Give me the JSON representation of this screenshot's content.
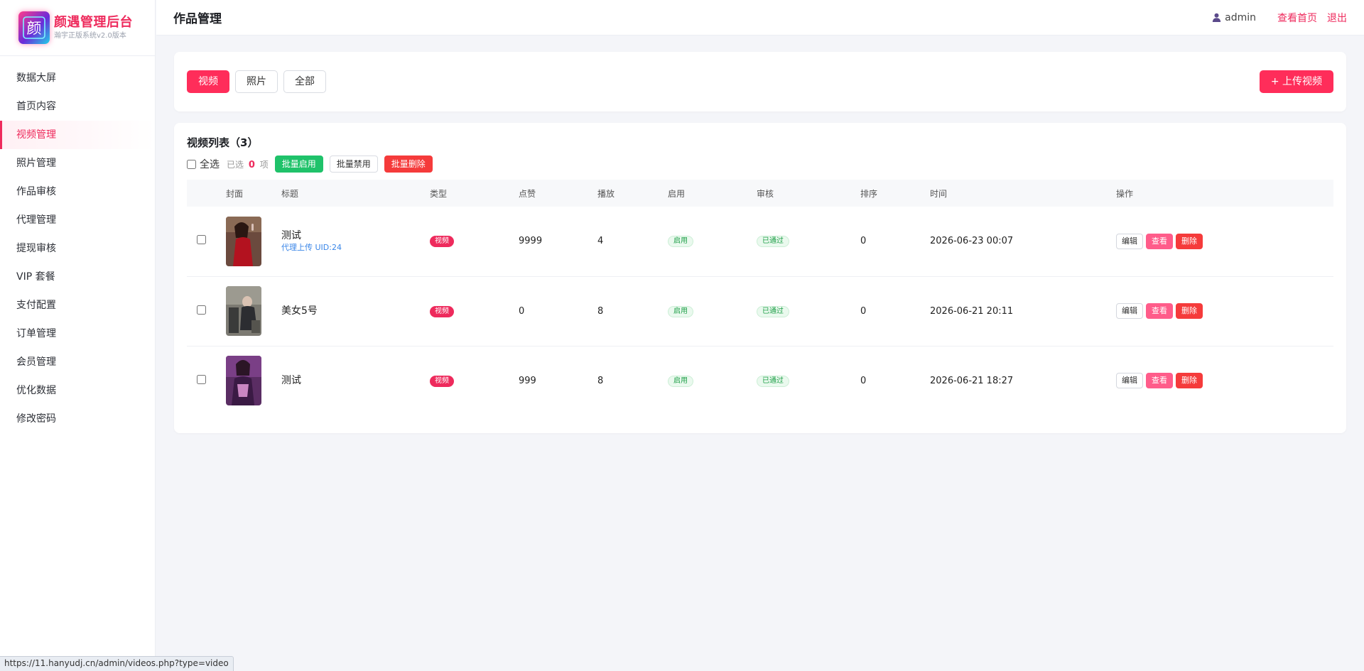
{
  "brand": {
    "title": "颜遇管理后台",
    "subtitle": "瀚宇正版系统v2.0版本",
    "logo_char": "颜"
  },
  "sidebar": {
    "items": [
      {
        "label": "数据大屏",
        "active": false
      },
      {
        "label": "首页内容",
        "active": false
      },
      {
        "label": "视频管理",
        "active": true
      },
      {
        "label": "照片管理",
        "active": false
      },
      {
        "label": "作品审核",
        "active": false
      },
      {
        "label": "代理管理",
        "active": false
      },
      {
        "label": "提现审核",
        "active": false
      },
      {
        "label": "VIP 套餐",
        "active": false
      },
      {
        "label": "支付配置",
        "active": false
      },
      {
        "label": "订单管理",
        "active": false
      },
      {
        "label": "会员管理",
        "active": false
      },
      {
        "label": "优化数据",
        "active": false
      },
      {
        "label": "修改密码",
        "active": false
      }
    ]
  },
  "header": {
    "title": "作品管理",
    "user": "admin",
    "home_link": "查看首页",
    "logout_link": "退出"
  },
  "filters": {
    "video": "视频",
    "photo": "照片",
    "all": "全部",
    "upload": "+ 上传视频"
  },
  "list": {
    "title": "视频列表（3）",
    "select_all": "全选",
    "selected_prefix": "已选",
    "selected_count": "0",
    "selected_suffix": "项",
    "batch_enable": "批量启用",
    "batch_disable": "批量禁用",
    "batch_delete": "批量删除",
    "columns": [
      "封面",
      "标题",
      "类型",
      "点赞",
      "播放",
      "启用",
      "审核",
      "排序",
      "时间",
      "操作"
    ],
    "ops": {
      "edit": "编辑",
      "view": "查看",
      "delete": "删除"
    },
    "rows": [
      {
        "title": "测试",
        "subtitle": "代理上传 UID:24",
        "type": "视频",
        "likes": "9999",
        "plays": "4",
        "enabled": "启用",
        "review": "已通过",
        "sort": "0",
        "time": "2026-06-23 00:07"
      },
      {
        "title": "美女5号",
        "subtitle": "",
        "type": "视频",
        "likes": "0",
        "plays": "8",
        "enabled": "启用",
        "review": "已通过",
        "sort": "0",
        "time": "2026-06-21 20:11"
      },
      {
        "title": "测试",
        "subtitle": "",
        "type": "视频",
        "likes": "999",
        "plays": "8",
        "enabled": "启用",
        "review": "已通过",
        "sort": "0",
        "time": "2026-06-21 18:27"
      }
    ]
  },
  "status_url": "https://11.hanyudj.cn/admin/videos.php?type=video",
  "colors": {
    "accent": "#ee2a5c",
    "green": "#1fc26a",
    "danger": "#f53b3b",
    "link": "#3a86e8"
  }
}
